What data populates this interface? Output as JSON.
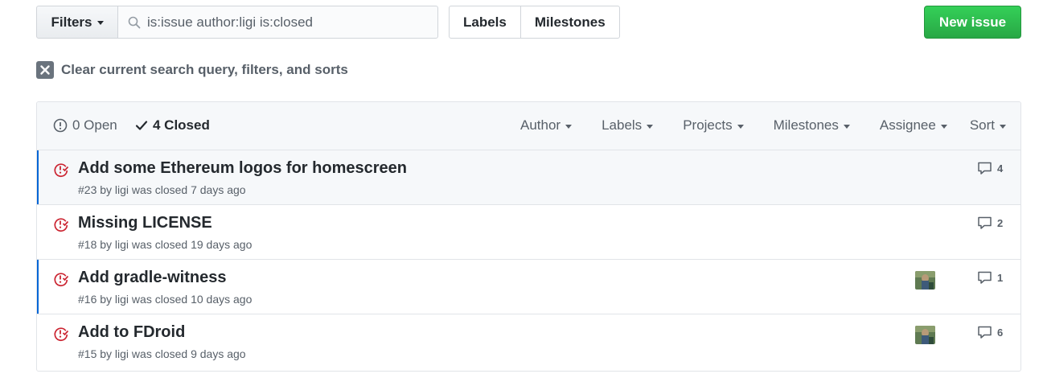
{
  "toolbar": {
    "filters_label": "Filters",
    "search_value": "is:issue author:ligi is:closed",
    "labels_label": "Labels",
    "milestones_label": "Milestones",
    "new_issue_label": "New issue"
  },
  "clear": {
    "label": "Clear current search query, filters, and sorts"
  },
  "header": {
    "open_label": "0 Open",
    "closed_label": "4 Closed",
    "filters": [
      "Author",
      "Labels",
      "Projects",
      "Milestones",
      "Assignee",
      "Sort"
    ]
  },
  "issues": [
    {
      "title": "Add some Ethereum logos for homescreen",
      "meta": "#23 by ligi was closed 7 days ago",
      "comments": "4",
      "has_assignee": false
    },
    {
      "title": "Missing LICENSE",
      "meta": "#18 by ligi was closed 19 days ago",
      "comments": "2",
      "has_assignee": false
    },
    {
      "title": "Add gradle-witness",
      "meta": "#16 by ligi was closed 10 days ago",
      "comments": "1",
      "has_assignee": true
    },
    {
      "title": "Add to FDroid",
      "meta": "#15 by ligi was closed 9 days ago",
      "comments": "6",
      "has_assignee": true
    }
  ],
  "colors": {
    "closed_red": "#cb2431",
    "primary_green": "#28a745",
    "unread_blue": "#0366d6"
  }
}
